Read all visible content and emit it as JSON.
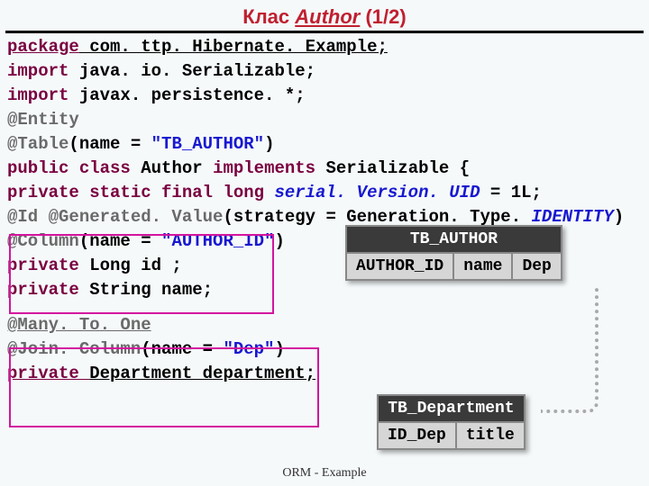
{
  "title_prefix": "Клас ",
  "title_word": "Author",
  "title_suffix": " (1/2)",
  "code": {
    "l1_pkg": "package",
    "l1_rest": " com. ttp. Hibernate. Example;",
    "l2_imp": "import",
    "l2_rest": " java. io. Serializable;",
    "l3_imp": "import",
    "l3_rest": " javax. persistence. *;",
    "l4": "@Entity",
    "l5a": "@Table",
    "l5b": "(name = ",
    "l5c": "\"TB_AUTHOR\"",
    "l5d": ")",
    "l6a": "public class ",
    "l6b": "Author ",
    "l6c": "implements ",
    "l6d": "Serializable {",
    "l7a": " private static final long ",
    "l7b": "serial. Version. UID",
    "l7c": " = 1L;",
    "l8a": " @Id  @Generated. Value",
    "l8b": "(strategy = Generation. Type. ",
    "l8c": "IDENTITY",
    "l8d": ")",
    "l9a": " @Column",
    "l9b": "(name = ",
    "l9c": "\"AUTHOR_ID\"",
    "l9d": ")",
    "l10a": " private ",
    "l10b": "Long id ;",
    "l11a": " private ",
    "l11b": "String name;",
    "l12": " @Many. To. One",
    "l13a": " @Join. Column",
    "l13b": "(name = ",
    "l13c": "\"Dep\"",
    "l13d": ")",
    "l14a": " private ",
    "l14b": "Department department;"
  },
  "table1": {
    "name": "TB_AUTHOR",
    "c1": "AUTHOR_ID",
    "c2": "name",
    "c3": "Dep"
  },
  "table2": {
    "name": "TB_Department",
    "c1": "ID_Dep",
    "c2": "title"
  },
  "footer": "ORM  -  Example"
}
